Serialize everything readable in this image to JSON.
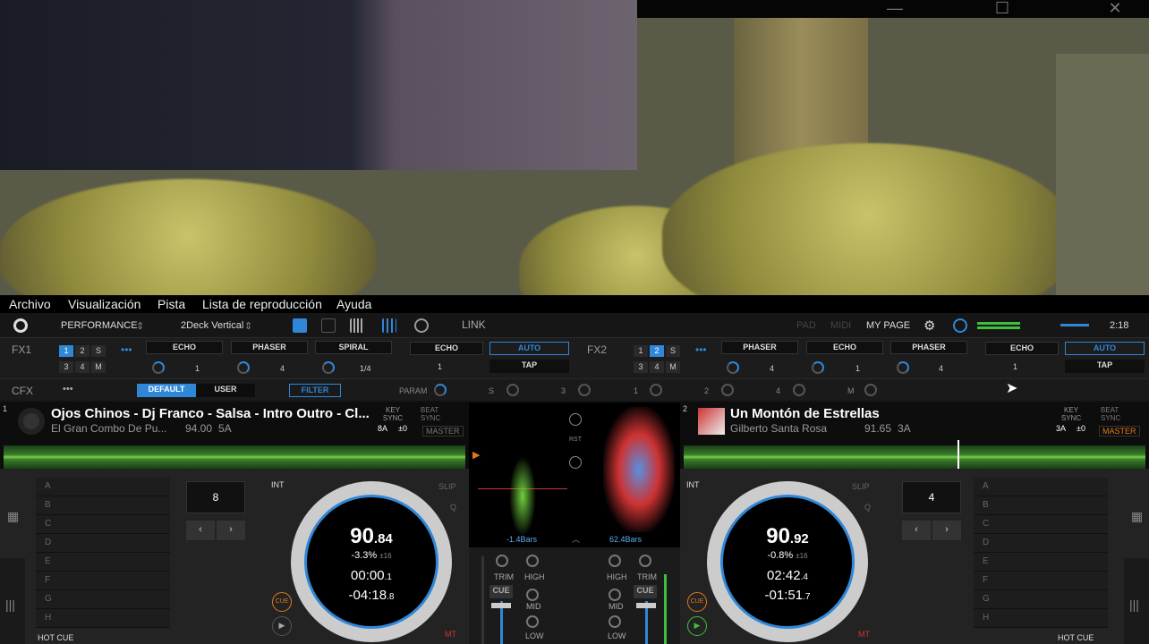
{
  "window": {
    "minimize_label": "—",
    "maximize_label": "☐",
    "close_label": "✕"
  },
  "menu": [
    "Archivo",
    "Visualización",
    "Pista",
    "Lista de reproducción",
    "Ayuda"
  ],
  "toolbar": {
    "mode": "PERFORMANCE",
    "layout": "2Deck Vertical",
    "link": "LINK",
    "pad": "PAD",
    "midi": "MIDI",
    "mypage": "MY PAGE",
    "time": "2:18"
  },
  "fx1": {
    "label": "FX1",
    "slots": [
      "1",
      "2",
      "S",
      "3",
      "4",
      "M"
    ],
    "effects": [
      "ECHO",
      "PHASER",
      "SPIRAL"
    ],
    "values": [
      "1",
      "4",
      "1/4"
    ],
    "beat_effect": "ECHO",
    "beat_value": "1",
    "auto": "AUTO",
    "tap": "TAP"
  },
  "fx2": {
    "label": "FX2",
    "slots": [
      "1",
      "2",
      "S",
      "3",
      "4",
      "M"
    ],
    "effects": [
      "PHASER",
      "ECHO",
      "PHASER"
    ],
    "values": [
      "4",
      "1",
      "4"
    ],
    "beat_effect": "ECHO",
    "beat_value": "1",
    "auto": "AUTO",
    "tap": "TAP"
  },
  "cfx": {
    "label": "CFX",
    "default": "DEFAULT",
    "user": "USER",
    "filter": "FILTER",
    "param": "PARAM",
    "channels": [
      "S",
      "3",
      "1",
      "2",
      "4",
      "M"
    ]
  },
  "deck1": {
    "num": "1",
    "title": "Ojos Chinos - Dj Franco - Salsa - Intro Outro - Cl...",
    "artist": "El Gran Combo De Pu...",
    "bpm": "94.00",
    "key": "5A",
    "key_label": "KEY\nSYNC",
    "beat_sync": "BEAT\nSYNC",
    "master": "MASTER",
    "key_shift": "8A",
    "key_offset": "±0",
    "bpm_big": "90",
    "bpm_dec": ".84",
    "pitch": "-3.3%",
    "range": "±16",
    "elapsed": "00:00",
    "elapsed_dec": ".1",
    "remain": "-04:18",
    "remain_dec": ".8",
    "int": "INT",
    "slip": "SLIP",
    "q": "Q",
    "cue": "CUE",
    "mt": "MT",
    "beat_jump": "8",
    "hotcue": "HOT CUE",
    "pads": [
      "A",
      "B",
      "C",
      "D",
      "E",
      "F",
      "G",
      "H"
    ]
  },
  "deck2": {
    "num": "2",
    "title": "Un Montón de Estrellas",
    "artist": "Gilberto Santa Rosa",
    "bpm": "91.65",
    "key": "3A",
    "key_label": "KEY\nSYNC",
    "beat_sync": "BEAT\nSYNC",
    "master": "MASTER",
    "key_shift": "3A",
    "key_offset": "±0",
    "bpm_big": "90",
    "bpm_dec": ".92",
    "pitch": "-0.8%",
    "range": "±16",
    "elapsed": "02:42",
    "elapsed_dec": ".4",
    "remain": "-01:51",
    "remain_dec": ".7",
    "int": "INT",
    "slip": "SLIP",
    "q": "Q",
    "cue": "CUE",
    "mt": "MT",
    "beat_jump": "4",
    "hotcue": "HOT CUE",
    "pads": [
      "A",
      "B",
      "C",
      "D",
      "E",
      "F",
      "G",
      "H"
    ]
  },
  "center": {
    "bars_left": "-1.4Bars",
    "bars_right": "62.4Bars",
    "rst": "RST",
    "trim": "TRIM",
    "high": "HIGH",
    "mid": "MID",
    "low": "LOW",
    "cue": "CUE"
  },
  "colors": {
    "accent": "#2f87d8",
    "master": "#e07a1a",
    "wave": "#6fcf3f"
  }
}
